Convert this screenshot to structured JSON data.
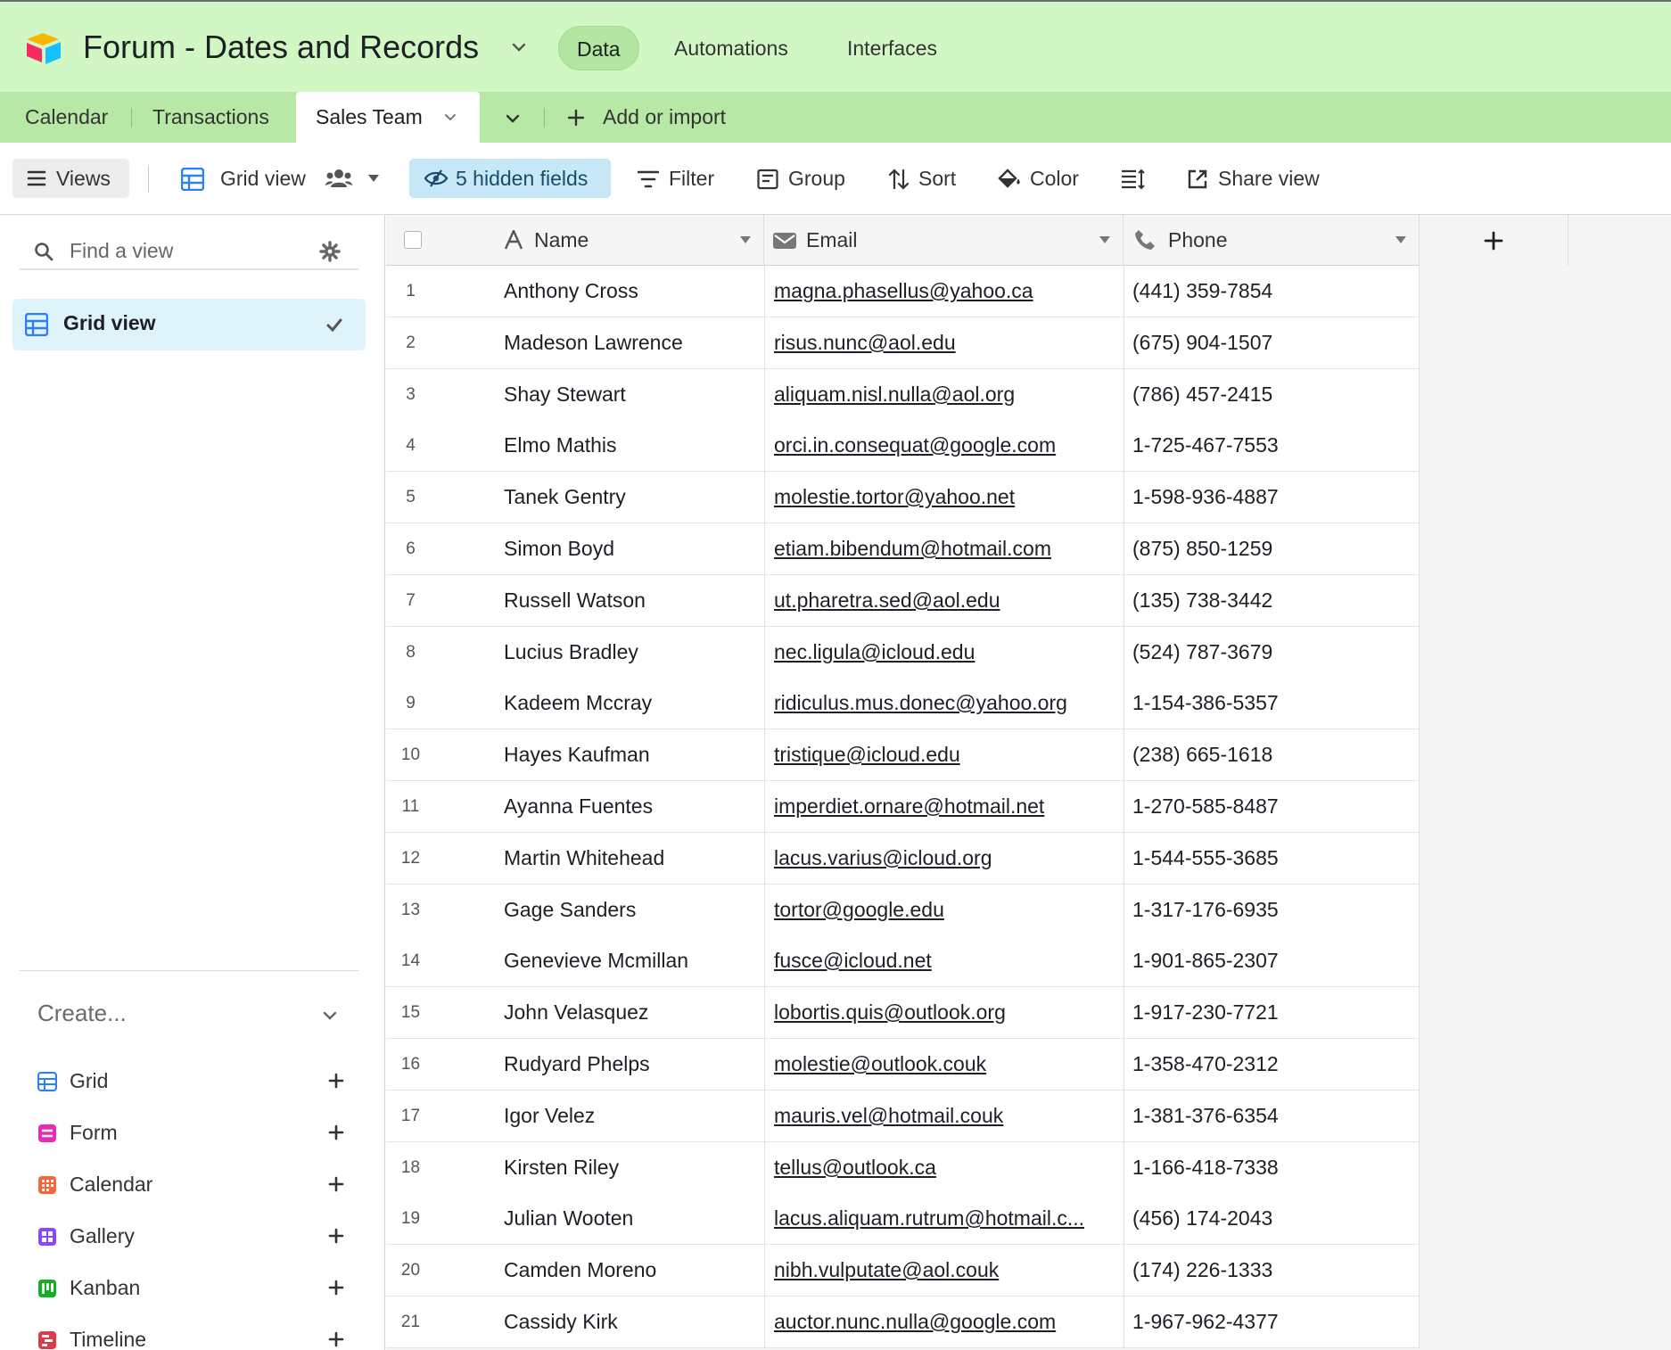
{
  "app": {
    "base_title": "Forum - Dates and Records",
    "nav": [
      "Data",
      "Automations",
      "Interfaces"
    ],
    "active_nav": "Data"
  },
  "tables": {
    "tabs": [
      "Calendar",
      "Transactions",
      "Sales Team"
    ],
    "active": "Sales Team",
    "add_label": "Add or import"
  },
  "toolbar": {
    "views_label": "Views",
    "view_name": "Grid view",
    "hidden_fields": "5 hidden fields",
    "filter": "Filter",
    "group": "Group",
    "sort": "Sort",
    "color": "Color",
    "share": "Share view"
  },
  "sidebar": {
    "find_placeholder": "Find a view",
    "current_view": "Grid view",
    "create_label": "Create...",
    "create_items": [
      {
        "label": "Grid",
        "color": "#2d7ff9"
      },
      {
        "label": "Form",
        "color": "#e929ba"
      },
      {
        "label": "Calendar",
        "color": "#f7653b"
      },
      {
        "label": "Gallery",
        "color": "#8b46ff"
      },
      {
        "label": "Kanban",
        "color": "#11af22"
      },
      {
        "label": "Timeline",
        "color": "#e0394a"
      }
    ]
  },
  "grid": {
    "columns": [
      "Name",
      "Email",
      "Phone"
    ],
    "rows": [
      {
        "n": "1",
        "name": "Anthony Cross",
        "email": "magna.phasellus@yahoo.ca",
        "phone": "(441) 359-7854"
      },
      {
        "n": "2",
        "name": "Madeson Lawrence",
        "email": "risus.nunc@aol.edu",
        "phone": "(675) 904-1507"
      },
      {
        "n": "3",
        "name": "Shay Stewart",
        "email": "aliquam.nisl.nulla@aol.org",
        "phone": "(786) 457-2415"
      },
      {
        "n": "4",
        "name": "Elmo Mathis",
        "email": "orci.in.consequat@google.com",
        "phone": "1-725-467-7553"
      },
      {
        "n": "5",
        "name": "Tanek Gentry",
        "email": "molestie.tortor@yahoo.net",
        "phone": "1-598-936-4887"
      },
      {
        "n": "6",
        "name": "Simon Boyd",
        "email": "etiam.bibendum@hotmail.com",
        "phone": "(875) 850-1259"
      },
      {
        "n": "7",
        "name": "Russell Watson",
        "email": "ut.pharetra.sed@aol.edu",
        "phone": "(135) 738-3442"
      },
      {
        "n": "8",
        "name": "Lucius Bradley",
        "email": "nec.ligula@icloud.edu",
        "phone": "(524) 787-3679"
      },
      {
        "n": "9",
        "name": "Kadeem Mccray",
        "email": "ridiculus.mus.donec@yahoo.org",
        "phone": "1-154-386-5357"
      },
      {
        "n": "10",
        "name": "Hayes Kaufman",
        "email": "tristique@icloud.edu",
        "phone": "(238) 665-1618"
      },
      {
        "n": "11",
        "name": "Ayanna Fuentes",
        "email": "imperdiet.ornare@hotmail.net",
        "phone": "1-270-585-8487"
      },
      {
        "n": "12",
        "name": "Martin Whitehead",
        "email": "lacus.varius@icloud.org",
        "phone": "1-544-555-3685"
      },
      {
        "n": "13",
        "name": "Gage Sanders",
        "email": "tortor@google.edu",
        "phone": "1-317-176-6935"
      },
      {
        "n": "14",
        "name": "Genevieve Mcmillan",
        "email": "fusce@icloud.net",
        "phone": "1-901-865-2307"
      },
      {
        "n": "15",
        "name": "John Velasquez",
        "email": "lobortis.quis@outlook.org",
        "phone": "1-917-230-7721"
      },
      {
        "n": "16",
        "name": "Rudyard Phelps",
        "email": "molestie@outlook.couk",
        "phone": "1-358-470-2312"
      },
      {
        "n": "17",
        "name": "Igor Velez",
        "email": "mauris.vel@hotmail.couk",
        "phone": "1-381-376-6354"
      },
      {
        "n": "18",
        "name": "Kirsten Riley",
        "email": "tellus@outlook.ca",
        "phone": "1-166-418-7338"
      },
      {
        "n": "19",
        "name": "Julian Wooten",
        "email": "lacus.aliquam.rutrum@hotmail.c...",
        "phone": "(456) 174-2043"
      },
      {
        "n": "20",
        "name": "Camden Moreno",
        "email": "nibh.vulputate@aol.couk",
        "phone": "(174) 226-1333"
      },
      {
        "n": "21",
        "name": "Cassidy Kirk",
        "email": "auctor.nunc.nulla@google.com",
        "phone": "1-967-962-4377"
      }
    ]
  },
  "colors": {
    "appbar": "#d1f7c4",
    "tabbar": "#b8e8a6",
    "selected_view": "#dff3fb",
    "hidden_fields": "#c6e8f7",
    "grid_icon": "#2d7ff9"
  }
}
